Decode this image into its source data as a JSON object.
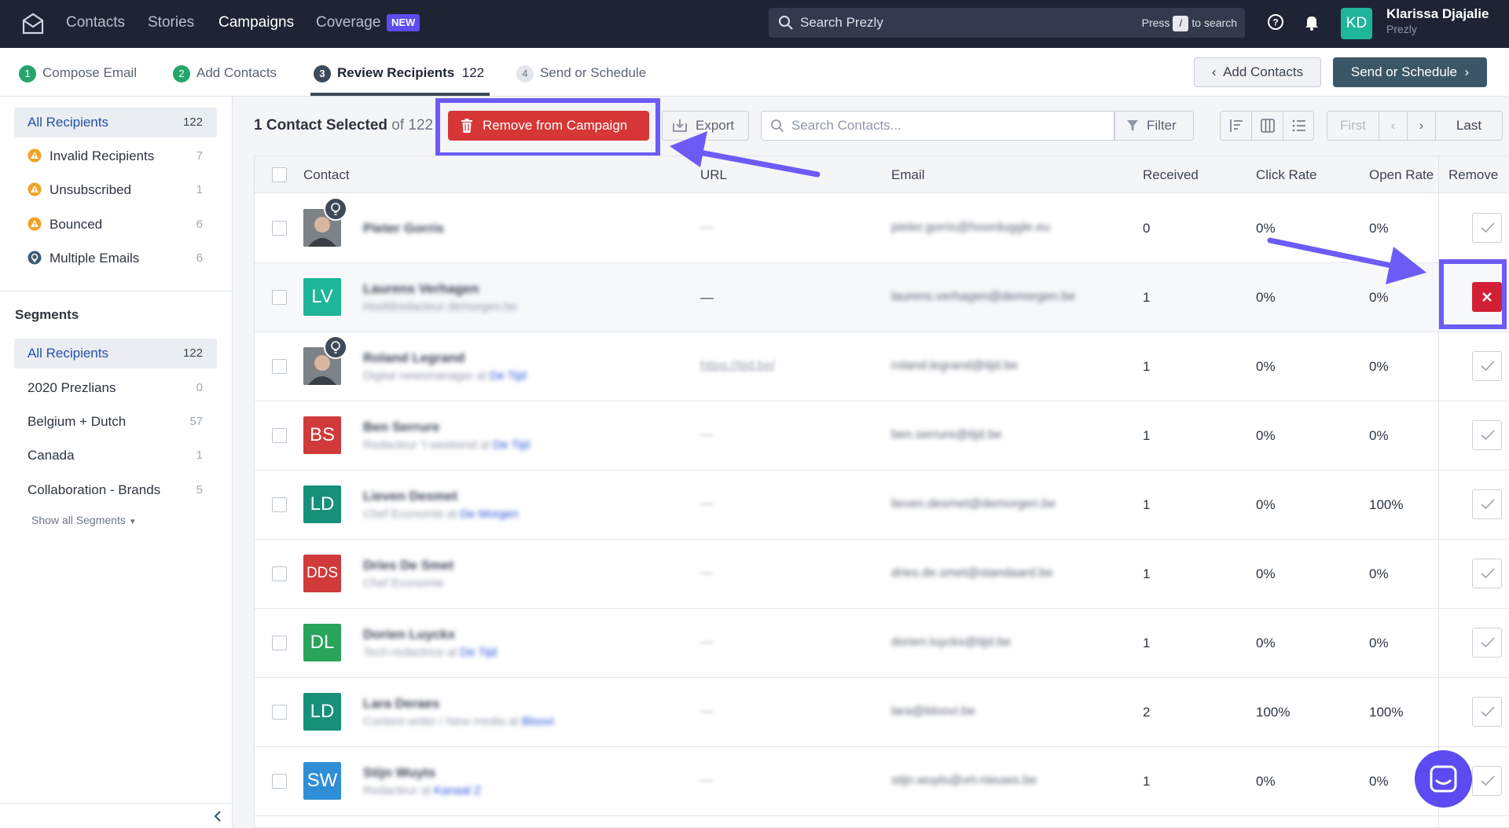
{
  "topnav": {
    "links": [
      "Contacts",
      "Stories",
      "Campaigns",
      "Coverage"
    ],
    "active": "Campaigns",
    "new_badge": "NEW",
    "search_placeholder": "Search Prezly",
    "search_hint_before": "Press",
    "search_hint_key": "/",
    "search_hint_after": "to search",
    "avatar_initials": "KD",
    "user_name": "Klarissa Djajalie",
    "user_org": "Prezly",
    "avatar_color": "#1fb59b"
  },
  "steps": [
    {
      "num": "1",
      "label": "Compose Email",
      "state": "done"
    },
    {
      "num": "2",
      "label": "Add Contacts",
      "state": "done"
    },
    {
      "num": "3",
      "label": "Review Recipients",
      "count": "122",
      "state": "current"
    },
    {
      "num": "4",
      "label": "Send or Schedule",
      "state": "todo"
    }
  ],
  "header_buttons": {
    "add_contacts": "Add Contacts",
    "send_or_schedule": "Send or Schedule"
  },
  "sidebar": {
    "filters": [
      {
        "label": "All Recipients",
        "count": "122",
        "active": true,
        "icon": ""
      },
      {
        "label": "Invalid Recipients",
        "count": "7",
        "icon": "warning-icon"
      },
      {
        "label": "Unsubscribed",
        "count": "1",
        "icon": "warning-icon"
      },
      {
        "label": "Bounced",
        "count": "6",
        "icon": "warning-icon"
      },
      {
        "label": "Multiple Emails",
        "count": "6",
        "icon": "location-pin-icon"
      }
    ],
    "segments_title": "Segments",
    "segments": [
      {
        "label": "All Recipients",
        "count": "122",
        "active": true
      },
      {
        "label": "2020 Prezlians",
        "count": "0"
      },
      {
        "label": "Belgium + Dutch",
        "count": "57"
      },
      {
        "label": "Canada",
        "count": "1"
      },
      {
        "label": "Collaboration - Brands",
        "count": "5"
      }
    ],
    "show_all": "Show all Segments"
  },
  "toolbar": {
    "selected_text": "1 Contact Selected",
    "of_text": "of 122",
    "remove_button": "Remove from Campaign",
    "export_button": "Export",
    "search_placeholder": "Search Contacts...",
    "filter_button": "Filter",
    "pager": {
      "first": "First",
      "last": "Last"
    }
  },
  "table": {
    "headers": {
      "contact": "Contact",
      "url": "URL",
      "email": "Email",
      "received": "Received",
      "click_rate": "Click Rate",
      "open_rate": "Open Rate",
      "remove": "Remove"
    },
    "rows": [
      {
        "initials": "",
        "photo": true,
        "bulb": true,
        "name": "Pieter Gorris",
        "subtitle": "",
        "company": "",
        "url": "—",
        "email": "pieter.gorris@hoorduggle.eu",
        "received": "0",
        "click_rate": "0%",
        "open_rate": "0%",
        "removed": false
      },
      {
        "initials": "LV",
        "color": "#1fb59b",
        "name": "Laurens Verhagen",
        "subtitle": "Hoofdredacteur demorgen.be",
        "company": "",
        "url": "—",
        "email": "laurens.verhagen@demorgen.be",
        "received": "1",
        "click_rate": "0%",
        "open_rate": "0%",
        "removed": true,
        "selected": true
      },
      {
        "initials": "",
        "photo": true,
        "bulb": true,
        "name": "Roland Legrand",
        "subtitle": "Digital newsmanager at",
        "company": "De Tijd",
        "url": "https://tijd.be/",
        "email": "roland.legrand@tijd.be",
        "received": "1",
        "click_rate": "0%",
        "open_rate": "0%",
        "removed": false
      },
      {
        "initials": "BS",
        "color": "#d03a3a",
        "name": "Ben Serrure",
        "subtitle": "Redacteur 't weekend at",
        "company": "De Tijd",
        "url": "—",
        "email": "ben.serrure@tijd.be",
        "received": "1",
        "click_rate": "0%",
        "open_rate": "0%",
        "removed": false
      },
      {
        "initials": "LD",
        "color": "#17907a",
        "name": "Lieven Desmet",
        "subtitle": "Chef Economie at",
        "company": "De Morgen",
        "url": "—",
        "email": "lieven.desmet@demorgen.be",
        "received": "1",
        "click_rate": "0%",
        "open_rate": "100%",
        "removed": false
      },
      {
        "initials": "DDS",
        "color": "#d03a3a",
        "name": "Dries De Smet",
        "subtitle": "Chef Economie",
        "company": "",
        "url": "—",
        "email": "dries.de.smet@standaard.be",
        "received": "1",
        "click_rate": "0%",
        "open_rate": "0%",
        "removed": false
      },
      {
        "initials": "DL",
        "color": "#28a55a",
        "name": "Dorien Luyckx",
        "subtitle": "Tech-redactrice at",
        "company": "De Tijd",
        "url": "—",
        "email": "dorien.luyckx@tijd.be",
        "received": "1",
        "click_rate": "0%",
        "open_rate": "0%",
        "removed": false
      },
      {
        "initials": "LD",
        "color": "#17907a",
        "name": "Lara Deraes",
        "subtitle": "Content writer / New media at",
        "company": "Bloovi",
        "url": "—",
        "email": "lara@bloovi.be",
        "received": "2",
        "click_rate": "100%",
        "open_rate": "100%",
        "removed": false
      },
      {
        "initials": "SW",
        "color": "#2f8fd6",
        "name": "Stijn Wuyts",
        "subtitle": "Redacteur at",
        "company": "Kanaal Z",
        "url": "—",
        "email": "stijn.wuyts@vrt-nieuws.be",
        "received": "1",
        "click_rate": "0%",
        "open_rate": "0%",
        "removed": false
      }
    ]
  },
  "colors": {
    "nav_bg": "#1e2433",
    "remove_red": "#d63636",
    "highlight": "#6c5cf5",
    "chat": "#5b4bf0"
  }
}
